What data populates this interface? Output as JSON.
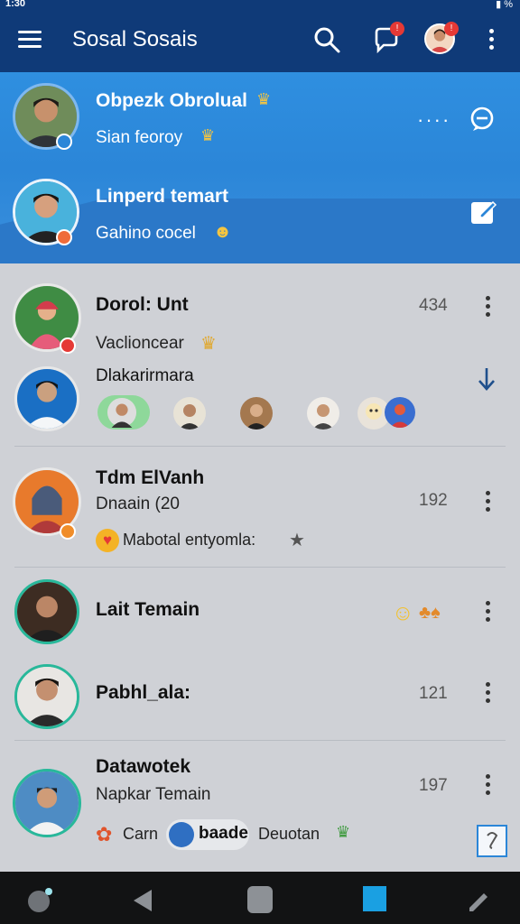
{
  "status": {
    "time": "1:30",
    "battery": "%"
  },
  "app": {
    "title": "Sosal Sosais"
  },
  "header_badges": {
    "chat": "!",
    "profile": "!"
  },
  "blue_rows": [
    {
      "name": "Obpezk Obrolual",
      "subtitle": "Sian feoroy"
    },
    {
      "name": "Linperd temart",
      "subtitle": "Gahino cocel"
    }
  ],
  "chats": [
    {
      "name": "Dorol: Unt",
      "subtitle": "Vaclioncear",
      "count": "434"
    },
    {
      "name": "Dlakarirmara"
    },
    {
      "name": "Tdm ElVanh",
      "subtitle": "Dnaain",
      "subtitle_suffix": "(20",
      "count": "192",
      "status_text": "Mabotal entyomla:"
    },
    {
      "name": "Lait Temain"
    },
    {
      "name": "Pabhl_ala:",
      "count": "121"
    },
    {
      "name": "Datawotek",
      "subtitle": "Napkar Temain",
      "count": "197",
      "tags": [
        "Carn",
        "baade",
        "Deuotan"
      ]
    }
  ]
}
